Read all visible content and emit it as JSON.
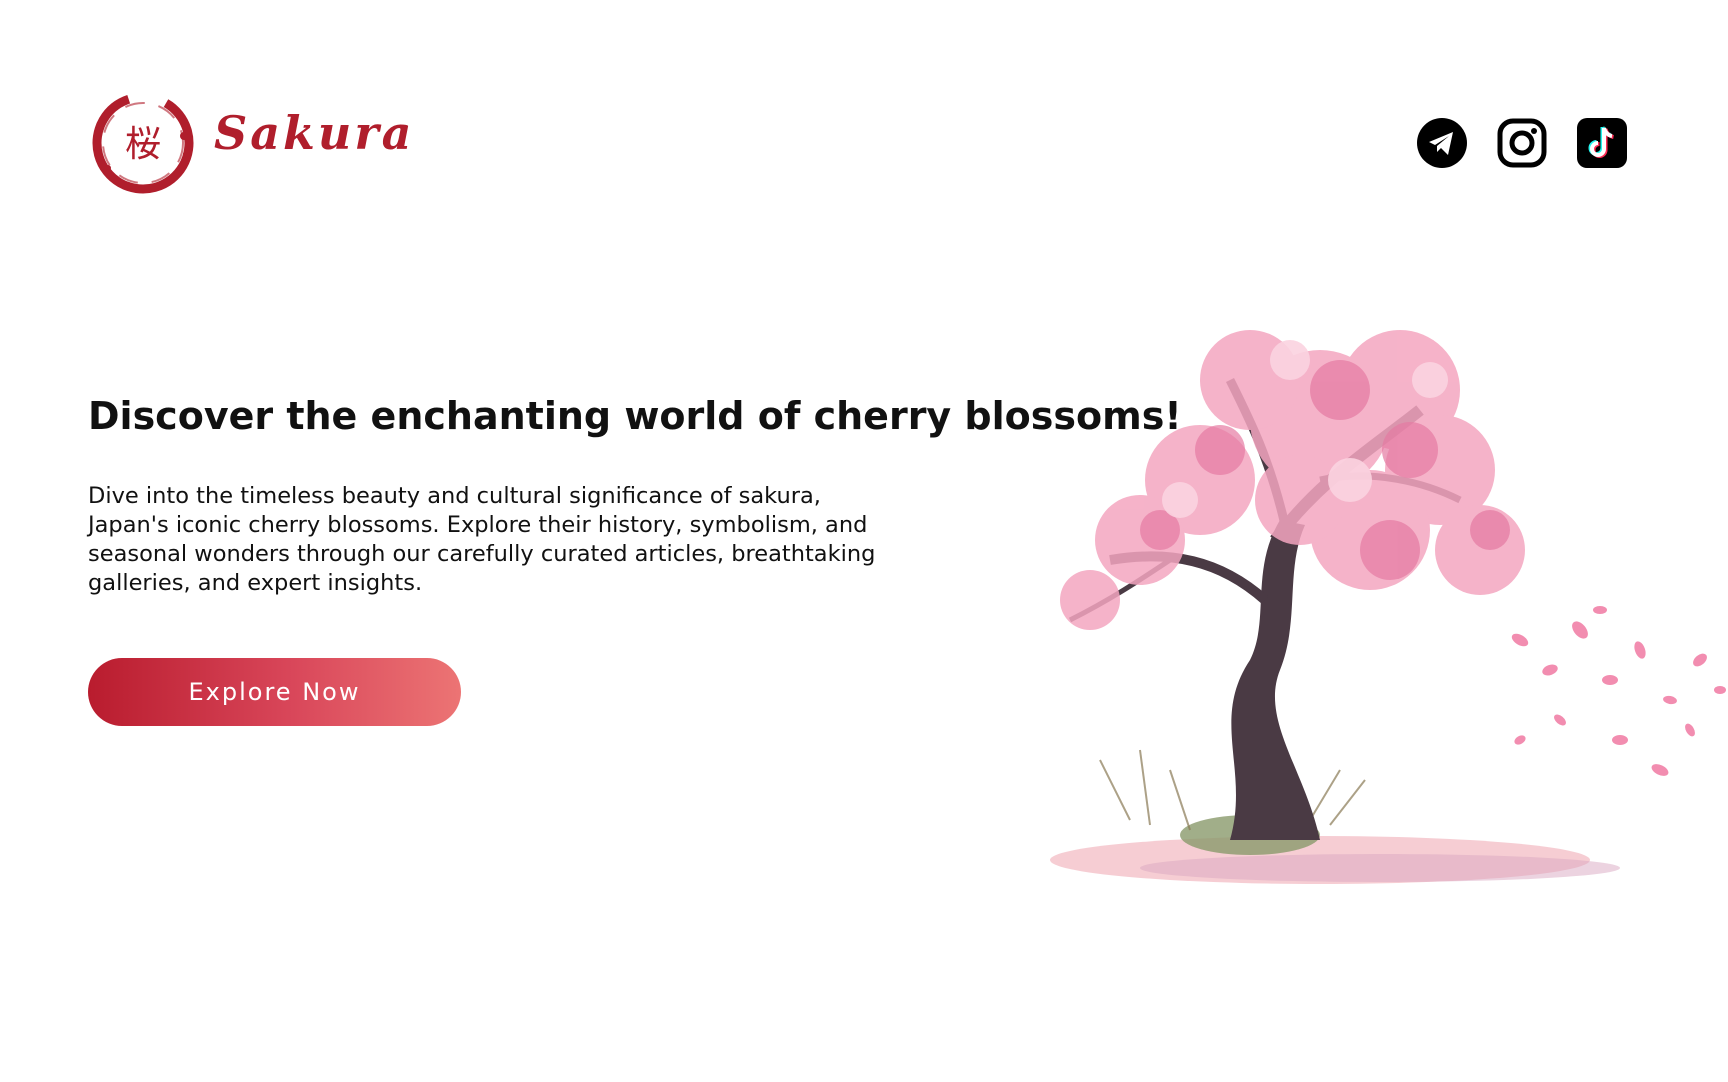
{
  "header": {
    "brand_mark_glyph": "桜",
    "brand_name": "Sakura",
    "brand_color": "#b01e2c",
    "socials": [
      {
        "name": "telegram",
        "icon": "telegram-icon"
      },
      {
        "name": "instagram",
        "icon": "instagram-icon"
      },
      {
        "name": "tiktok",
        "icon": "tiktok-icon"
      }
    ]
  },
  "hero": {
    "title": "Discover the enchanting world of cherry blossoms!",
    "body": "Dive into the timeless beauty and cultural significance of sakura, Japan's iconic cherry blossoms. Explore their history, symbolism, and seasonal wonders through our carefully curated articles, breathtaking galleries, and expert insights.",
    "cta_label": "Explore Now",
    "cta_gradient": [
      "#b91c2e",
      "#ec7474"
    ]
  },
  "illustration": {
    "name": "cherry-blossom-tree",
    "blossom_color": "#f4a6c0",
    "trunk_color": "#4a3a44"
  }
}
